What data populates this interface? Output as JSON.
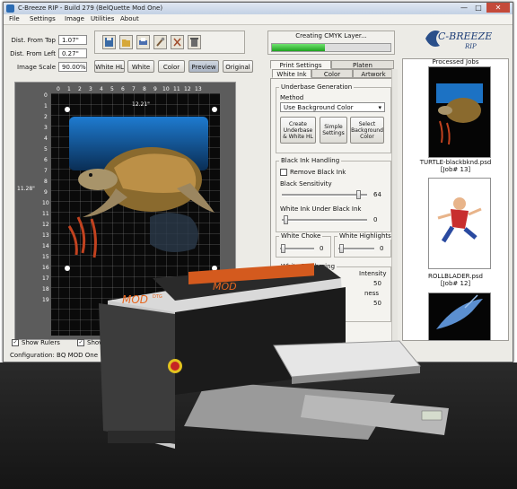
{
  "window": {
    "title": "C-Breeze RIP  -  Build 279 (BelQuette Mod One)",
    "controls": {
      "minimize": "—",
      "maximize": "□",
      "close": "✕"
    }
  },
  "menu": [
    "File",
    "Settings",
    "Image",
    "Utilities",
    "About"
  ],
  "fields": {
    "from_top": {
      "label": "Dist. From Top",
      "value": "1.07\""
    },
    "from_left": {
      "label": "Dist. From Left",
      "value": "0.27\""
    },
    "image_scale": {
      "label": "Image Scale",
      "value": "90.00%"
    }
  },
  "toolbar_icons": [
    "save-icon",
    "open-icon",
    "print-icon",
    "wrench-icon",
    "tools-icon",
    "trash-icon"
  ],
  "view_buttons": [
    {
      "label": "White HL"
    },
    {
      "label": "White"
    },
    {
      "label": "Color"
    },
    {
      "label": "Preview"
    },
    {
      "label": "Original"
    }
  ],
  "rulers": {
    "top": [
      "0",
      "1",
      "2",
      "3",
      "4",
      "5",
      "6",
      "7",
      "8",
      "9",
      "10",
      "11",
      "12",
      "13"
    ],
    "left": [
      "0",
      "1",
      "2",
      "3",
      "4",
      "5",
      "6",
      "7",
      "8",
      "9",
      "10",
      "11",
      "12",
      "13",
      "14",
      "15",
      "16",
      "17",
      "18",
      "19"
    ],
    "top_dimension": "12.21\"",
    "left_dimension": "11.28\""
  },
  "bottom": {
    "show_rulers": "Show Rulers",
    "show_grid": "Show",
    "configuration": "Configuration: BQ MOD One"
  },
  "progress": {
    "status": "Creating CMYK Layer...",
    "fraction": 0.45
  },
  "main_tabs": [
    "Print Settings",
    "Platen"
  ],
  "sub_tabs": [
    "White Ink",
    "Color",
    "Artwork"
  ],
  "underbase": {
    "group_title": "Underbase Generation",
    "method_label": "Method",
    "method_value": "Use Background Color",
    "buttons": [
      "Create Underbase & White HL",
      "Simple Settings",
      "Select Background Color"
    ]
  },
  "black_ink": {
    "group_title": "Black Ink Handling",
    "remove_label": "Remove Black Ink",
    "sensitivity_label": "Black Sensitivity",
    "sensitivity_value": "64",
    "white_under_label": "White Ink Under Black Ink",
    "white_under_value": "0"
  },
  "choke": {
    "white_choke_label": "White Choke",
    "white_choke_value": "0",
    "highlights_label": "White Highlights",
    "highlights_value": "0"
  },
  "feathering": {
    "group_title": "White Feathering",
    "intensity_label": "Intensity",
    "intensity_value": "50",
    "second_label": "ness",
    "second_value": "50"
  },
  "jobs": {
    "title": "Processed Jobs",
    "items": [
      {
        "name": "TURTLE-blackbknd.psd",
        "job": "[Job# 13]"
      },
      {
        "name": "ROLLBLADER.psd",
        "job": "[Job# 12]"
      },
      {
        "name": "",
        "job": ""
      }
    ]
  },
  "logo": {
    "text": "C-BREEZE",
    "sub": "RIP"
  },
  "printer": {
    "brand": "MOD",
    "model": "DTG"
  }
}
